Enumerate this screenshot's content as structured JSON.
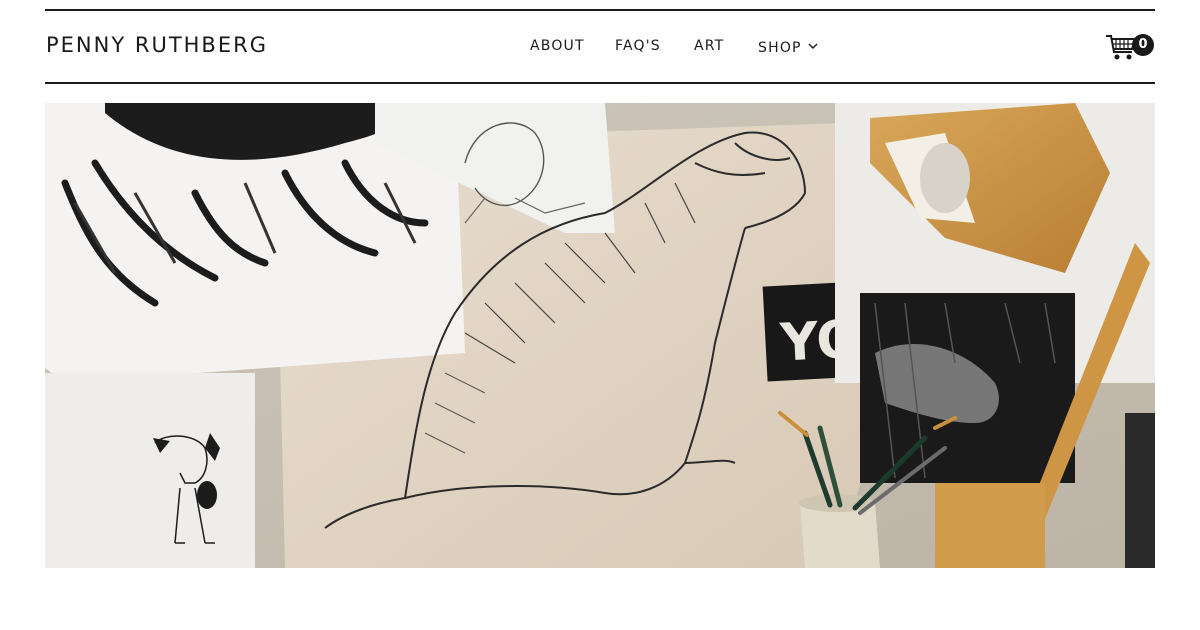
{
  "brand": {
    "name": "PENNY RUTHBERG"
  },
  "nav": {
    "items": [
      {
        "label": "ABOUT"
      },
      {
        "label": "FAQ'S"
      },
      {
        "label": "ART"
      },
      {
        "label": "SHOP"
      }
    ]
  },
  "cart": {
    "count": "0",
    "icon": "shopping-cart-icon"
  },
  "hero": {
    "stencil_text": "YOU"
  },
  "colors": {
    "text": "#1a1a1a",
    "background": "#ffffff"
  }
}
